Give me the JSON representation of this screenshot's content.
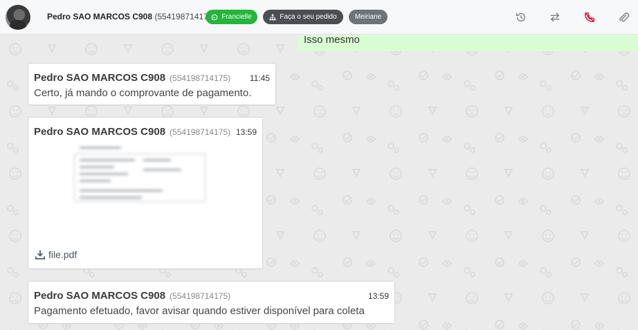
{
  "header": {
    "contact_name": "Pedro SAO MARCOS C908",
    "contact_phone": "(554198714175)",
    "tags": [
      {
        "label": "Francielle",
        "icon": "whatsapp-icon",
        "color": "#25b53c"
      },
      {
        "label": "Faça o seu pedido",
        "icon": "hierarchy-icon",
        "color": "#4b4e52"
      },
      {
        "label": "Meiriane",
        "icon": "",
        "color": "#6d737a"
      }
    ],
    "actions": [
      "history-icon",
      "transfer-icon",
      "end-call-icon",
      "attachment-icon"
    ]
  },
  "outgoing": {
    "text": "Isso mesmo"
  },
  "messages": [
    {
      "sender": "Pedro SAO MARCOS C908",
      "phone": "(554198714175)",
      "time": "11:45",
      "text": "Certo, já mando o comprovante de pagamento."
    },
    {
      "sender": "Pedro SAO MARCOS C908",
      "phone": "(554198714175)",
      "time": "13:59",
      "attachment": "file.pdf"
    },
    {
      "sender": "Pedro SAO MARCOS C908",
      "phone": "(554198714175)",
      "time": "13:59",
      "text": "Pagamento efetuado, favor avisar quando estiver disponível para coleta"
    }
  ],
  "colors": {
    "accent_green": "#25b53c",
    "end_call_red": "#d81b3c",
    "chat_bg": "#ebebeb",
    "outgoing_bg": "#d9fdd3"
  }
}
